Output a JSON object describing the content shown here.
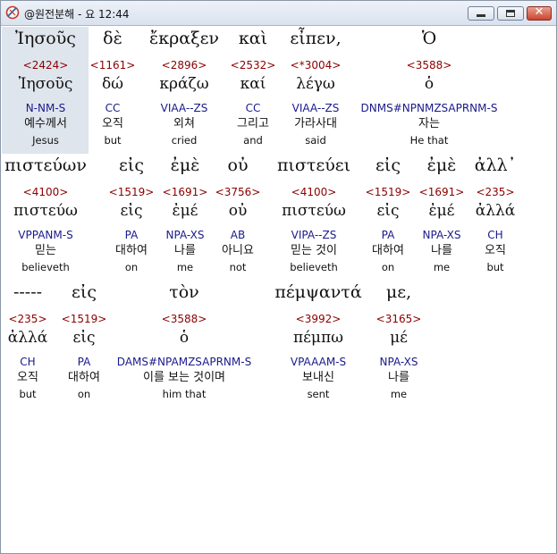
{
  "window": {
    "title": "@원전분해 - 요 12:44"
  },
  "rows": [
    {
      "words": [
        {
          "greek": "Ἰησοῦς",
          "strong": "<2424>",
          "lemma": "Ἰησοῦς",
          "parse": "N-NM-S",
          "korean": "예수께서",
          "english": "Jesus"
        },
        {
          "greek": "δὲ",
          "strong": "<1161>",
          "lemma": "δώ",
          "parse": "CC",
          "korean": "오직",
          "english": "but"
        },
        {
          "greek": "ἔκραξεν",
          "strong": "<2896>",
          "lemma": "κράζω",
          "parse": "VIAA--ZS",
          "korean": "외쳐",
          "english": "cried"
        },
        {
          "greek": "καὶ",
          "strong": "<2532>",
          "lemma": "καί",
          "parse": "CC",
          "korean": "그리고",
          "english": "and"
        },
        {
          "greek": "εἶπεν,",
          "strong": "<*3004>",
          "lemma": "λέγω",
          "parse": "VIAA--ZS",
          "korean": "가라사대",
          "english": "said"
        },
        {
          "greek": "Ὁ",
          "strong": "<3588>",
          "lemma": "ὁ",
          "parse": "DNMS#NPNMZSAPRNM-S",
          "korean": "자는",
          "english": "He that"
        }
      ]
    },
    {
      "words": [
        {
          "greek": "πιστεύων",
          "strong": "<4100>",
          "lemma": "πιστεύω",
          "parse": "VPPANM-S",
          "korean": "믿는",
          "english": "believeth"
        },
        {
          "greek": "εἰς",
          "strong": "<1519>",
          "lemma": "εἰς",
          "parse": "PA",
          "korean": "대하여",
          "english": "on"
        },
        {
          "greek": "ἐμὲ",
          "strong": "<1691>",
          "lemma": "ἐμέ",
          "parse": "NPA-XS",
          "korean": "나를",
          "english": "me"
        },
        {
          "greek": "οὐ",
          "strong": "<3756>",
          "lemma": "οὐ",
          "parse": "AB",
          "korean": "아니요",
          "english": "not"
        },
        {
          "greek": "πιστεύει",
          "strong": "<4100>",
          "lemma": "πιστεύω",
          "parse": "VIPA--ZS",
          "korean": "믿는 것이",
          "english": "believeth"
        },
        {
          "greek": "εἰς",
          "strong": "<1519>",
          "lemma": "εἰς",
          "parse": "PA",
          "korean": "대하여",
          "english": "on"
        },
        {
          "greek": "ἐμὲ",
          "strong": "<1691>",
          "lemma": "ἐμέ",
          "parse": "NPA-XS",
          "korean": "나를",
          "english": "me"
        },
        {
          "greek": "ἀλλ᾽",
          "strong": "<235>",
          "lemma": "ἀλλά",
          "parse": "CH",
          "korean": "오직",
          "english": "but"
        }
      ]
    },
    {
      "words": [
        {
          "greek": "-----",
          "strong": "<235>",
          "lemma": "ἀλλά",
          "parse": "CH",
          "korean": "오직",
          "english": "but"
        },
        {
          "greek": "εἰς",
          "strong": "<1519>",
          "lemma": "εἰς",
          "parse": "PA",
          "korean": "대하여",
          "english": "on"
        },
        {
          "greek": "τὸν",
          "strong": "<3588>",
          "lemma": "ὁ",
          "parse": "DAMS#NPAMZSAPRNM-S",
          "korean": "이를 보는 것이며",
          "english": "him that"
        },
        {
          "greek": "πέμψαντά",
          "strong": "<3992>",
          "lemma": "πέμπω",
          "parse": "VPAAAM-S",
          "korean": "보내신",
          "english": "sent"
        },
        {
          "greek": "με,",
          "strong": "<3165>",
          "lemma": "μέ",
          "parse": "NPA-XS",
          "korean": "나를",
          "english": "me"
        }
      ]
    }
  ]
}
